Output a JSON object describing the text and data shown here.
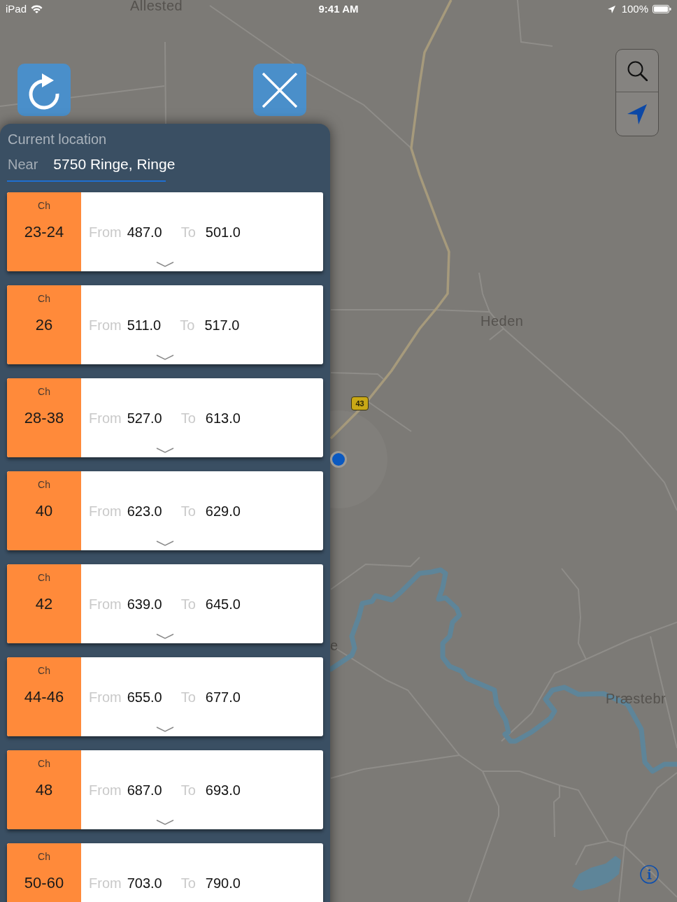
{
  "status_bar": {
    "device": "iPad",
    "time": "9:41 AM",
    "battery": "100%"
  },
  "map": {
    "labels": [
      "Allested",
      "Heden",
      "e",
      "Præstebr"
    ],
    "route_shield": "43"
  },
  "location_panel": {
    "title": "Current location",
    "near_label": "Near",
    "address": "5750 Ringe, Ringe"
  },
  "channels": [
    {
      "ch_label": "Ch",
      "channel": "23-24",
      "from_label": "From",
      "from": "487.0",
      "to_label": "To",
      "to": "501.0"
    },
    {
      "ch_label": "Ch",
      "channel": "26",
      "from_label": "From",
      "from": "511.0",
      "to_label": "To",
      "to": "517.0"
    },
    {
      "ch_label": "Ch",
      "channel": "28-38",
      "from_label": "From",
      "from": "527.0",
      "to_label": "To",
      "to": "613.0"
    },
    {
      "ch_label": "Ch",
      "channel": "40",
      "from_label": "From",
      "from": "623.0",
      "to_label": "To",
      "to": "629.0"
    },
    {
      "ch_label": "Ch",
      "channel": "42",
      "from_label": "From",
      "from": "639.0",
      "to_label": "To",
      "to": "645.0"
    },
    {
      "ch_label": "Ch",
      "channel": "44-46",
      "from_label": "From",
      "from": "655.0",
      "to_label": "To",
      "to": "677.0"
    },
    {
      "ch_label": "Ch",
      "channel": "48",
      "from_label": "From",
      "from": "687.0",
      "to_label": "To",
      "to": "693.0"
    },
    {
      "ch_label": "Ch",
      "channel": "50-60",
      "from_label": "From",
      "from": "703.0",
      "to_label": "To",
      "to": "790.0"
    }
  ]
}
